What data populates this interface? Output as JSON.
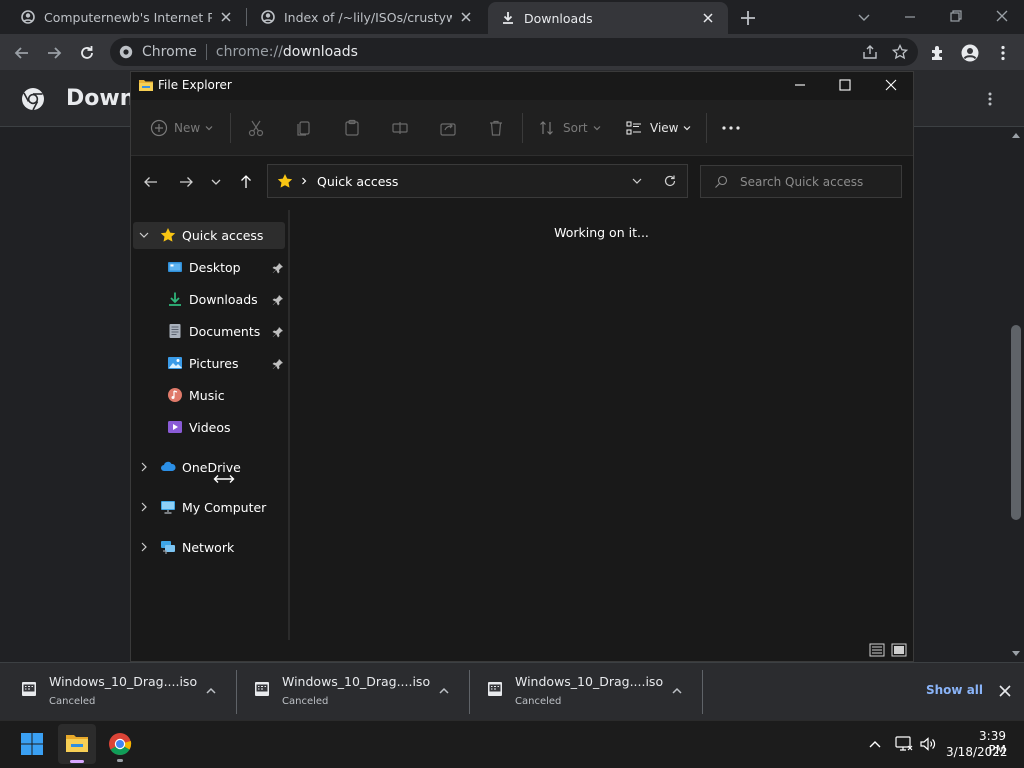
{
  "chrome": {
    "tabs": [
      {
        "title": "Computernewb's Internet Pub H",
        "icon": "site-favicon-icon"
      },
      {
        "title": "Index of /~lily/ISOs/crustywindo",
        "icon": "site-favicon-icon"
      },
      {
        "title": "Downloads",
        "icon": "download-icon"
      }
    ],
    "omnibox": {
      "site_label": "Chrome",
      "url_prefix": "chrome://",
      "url_path": "downloads"
    },
    "page_title": "Downl"
  },
  "explorer": {
    "title": "File Explorer",
    "commands": {
      "new": "New",
      "sort": "Sort",
      "view": "View"
    },
    "address": {
      "location": "Quick access"
    },
    "search_placeholder": "Search Quick access",
    "status": "Working on it...",
    "nav": {
      "quick_access": "Quick access",
      "pinned": [
        {
          "label": "Desktop",
          "icon": "desktop-folder-icon",
          "pinned": true
        },
        {
          "label": "Downloads",
          "icon": "downloads-folder-icon",
          "pinned": true
        },
        {
          "label": "Documents",
          "icon": "documents-folder-icon",
          "pinned": true
        },
        {
          "label": "Pictures",
          "icon": "pictures-folder-icon",
          "pinned": true
        },
        {
          "label": "Music",
          "icon": "music-folder-icon",
          "pinned": false
        },
        {
          "label": "Videos",
          "icon": "videos-folder-icon",
          "pinned": false
        }
      ],
      "roots": [
        {
          "label": "OneDrive",
          "icon": "onedrive-cloud-icon"
        },
        {
          "label": "My Computer",
          "icon": "computer-monitor-icon"
        },
        {
          "label": "Network",
          "icon": "network-icon"
        }
      ]
    }
  },
  "shelf": {
    "items": [
      {
        "name": "Windows_10_Drag....iso",
        "status": "Canceled"
      },
      {
        "name": "Windows_10_Drag....iso",
        "status": "Canceled"
      },
      {
        "name": "Windows_10_Drag....iso",
        "status": "Canceled"
      }
    ],
    "show_all": "Show all"
  },
  "taskbar": {
    "time": "3:39 PM",
    "date": "3/18/2022"
  },
  "colors": {
    "chrome_dark": "#202124",
    "chrome_toolbar": "#35363a",
    "link_blue": "#8ab4f8",
    "explorer_bg": "#191919",
    "star_yellow": "#f9c513"
  }
}
